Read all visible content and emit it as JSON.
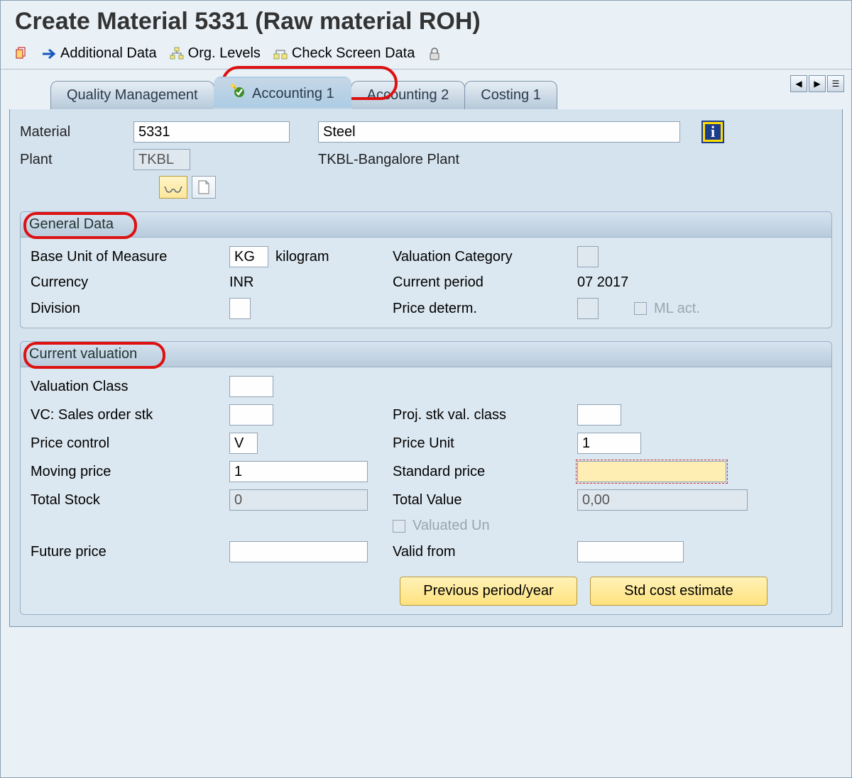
{
  "pageTitle": "Create Material 5331 (Raw material ROH)",
  "toolbar": {
    "additionalData": "Additional Data",
    "orgLevels": "Org. Levels",
    "checkScreenData": "Check Screen Data"
  },
  "tabs": {
    "t1": "Quality Management",
    "t2": "Accounting 1",
    "t3": "Accounting 2",
    "t4": "Costing 1"
  },
  "header": {
    "materialLabel": "Material",
    "materialNo": "5331",
    "materialDesc": "Steel",
    "plantLabel": "Plant",
    "plantCode": "TKBL",
    "plantName": "TKBL-Bangalore Plant"
  },
  "generalData": {
    "title": "General Data",
    "baseUomLabel": "Base Unit of Measure",
    "baseUom": "KG",
    "baseUomText": "kilogram",
    "valCatLabel": "Valuation Category",
    "valCat": "",
    "currencyLabel": "Currency",
    "currency": "INR",
    "currentPeriodLabel": "Current period",
    "currentPeriod": "07 2017",
    "divisionLabel": "Division",
    "division": "",
    "priceDetermLabel": "Price determ.",
    "priceDeterm": "",
    "mlActLabel": "ML act."
  },
  "currentValuation": {
    "title": "Current valuation",
    "valClassLabel": "Valuation Class",
    "valClass": "",
    "vcSalesLabel": "VC: Sales order stk",
    "vcSales": "",
    "projStkLabel": "Proj. stk val. class",
    "projStk": "",
    "priceControlLabel": "Price control",
    "priceControl": "V",
    "priceUnitLabel": "Price Unit",
    "priceUnit": "1",
    "movingPriceLabel": "Moving price",
    "movingPrice": "1",
    "stdPriceLabel": "Standard price",
    "stdPrice": "",
    "totalStockLabel": "Total Stock",
    "totalStock": "0",
    "totalValueLabel": "Total Value",
    "totalValue": "0,00",
    "valuatedUnLabel": "Valuated Un",
    "futurePriceLabel": "Future price",
    "futurePrice": "",
    "validFromLabel": "Valid from",
    "validFrom": "",
    "prevPeriodBtn": "Previous period/year",
    "stdCostBtn": "Std cost estimate"
  }
}
